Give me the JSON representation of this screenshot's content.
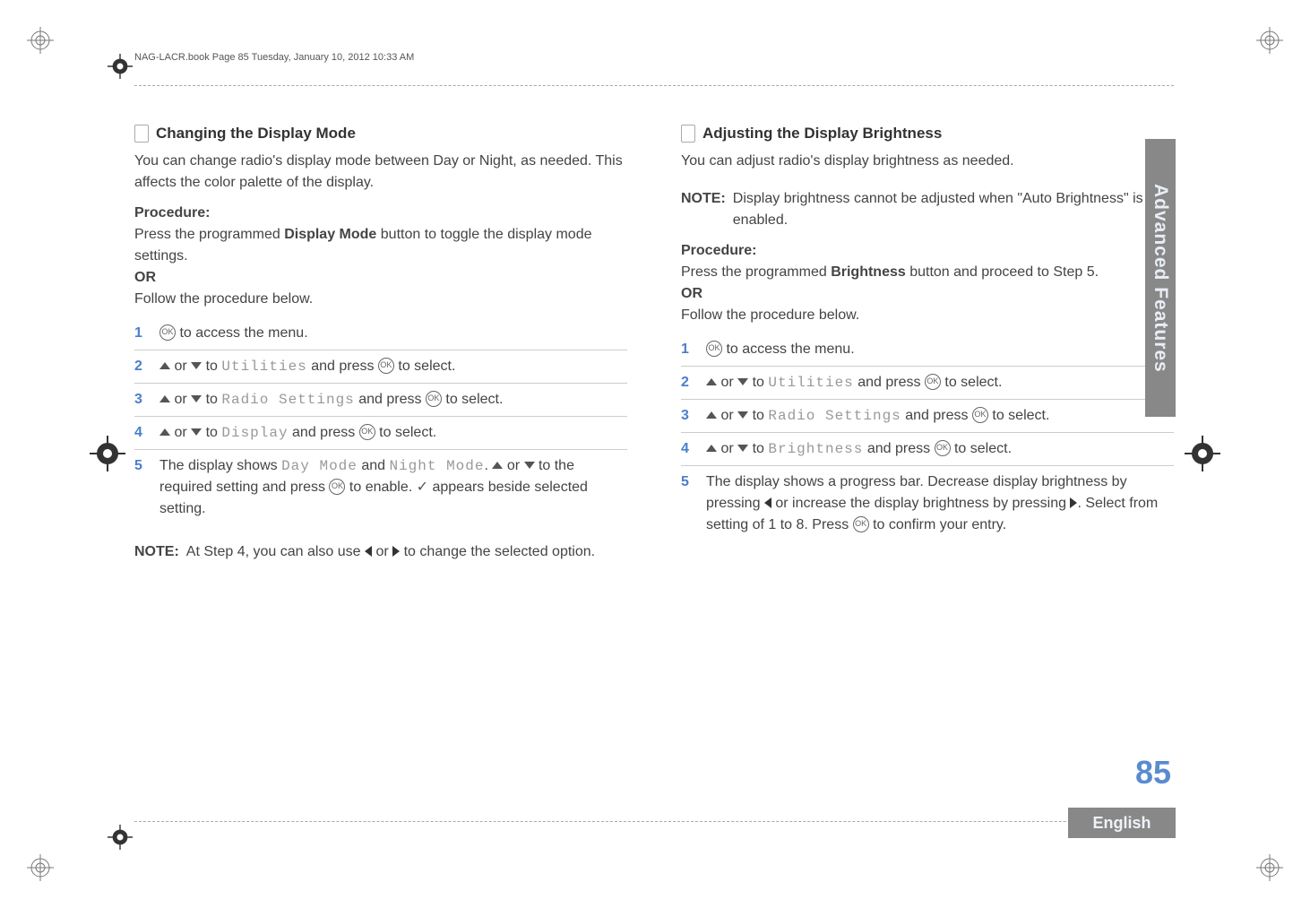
{
  "header": "NAG-LACR.book  Page 85  Tuesday, January 10, 2012  10:33 AM",
  "left": {
    "title": "Changing the Display Mode",
    "intro": "You can change radio's display mode between Day or Night, as needed. This affects the color palette of the display.",
    "procedure_label": "Procedure:",
    "proc_line1_a": "Press the programmed ",
    "proc_line1_b": "Display Mode",
    "proc_line1_c": " button to toggle the display mode settings.",
    "or_label": "OR",
    "proc_line2": "Follow the procedure below.",
    "step1": " to access the menu.",
    "step2_a": " or ",
    "step2_b": " to ",
    "step2_util": "Utilities",
    "step2_c": " and press ",
    "step2_d": " to select.",
    "step3_rs": "Radio Settings",
    "step4_disp": "Display",
    "step5_a": "The display shows ",
    "step5_day": "Day Mode",
    "step5_and": " and ",
    "step5_night": "Night Mode",
    "step5_b": ". ",
    "step5_c": " to the required setting and press ",
    "step5_d": " to enable. ",
    "step5_e": " appears beside selected setting.",
    "note_label": "NOTE:",
    "note_a": "At Step 4, you can also use ",
    "note_or": " or ",
    "note_b": " to change the selected option."
  },
  "right": {
    "title": "Adjusting the Display Brightness",
    "intro": "You can adjust radio's display brightness as needed.",
    "note_label": "NOTE:",
    "note_text": "Display brightness cannot be adjusted when \"Auto Brightness\" is enabled.",
    "procedure_label": "Procedure:",
    "proc_line1_a": "Press the programmed ",
    "proc_line1_b": "Brightness",
    "proc_line1_c": " button and proceed to Step 5.",
    "or_label": "OR",
    "proc_line2": "Follow the procedure below.",
    "step1": " to access the menu.",
    "step2_util": "Utilities",
    "step3_rs": "Radio Settings",
    "step4_br": "Brightness",
    "generic_or": " or ",
    "generic_to": " to ",
    "generic_press": " and press ",
    "generic_select": " to select.",
    "step5_a": "The display shows a progress bar. Decrease display brightness by pressing ",
    "step5_b": " or increase the display brightness by pressing ",
    "step5_c": ". Select from setting of 1 to 8. Press ",
    "step5_d": " to confirm your entry."
  },
  "side_tab": "Advanced Features",
  "page_number": "85",
  "language": "English"
}
